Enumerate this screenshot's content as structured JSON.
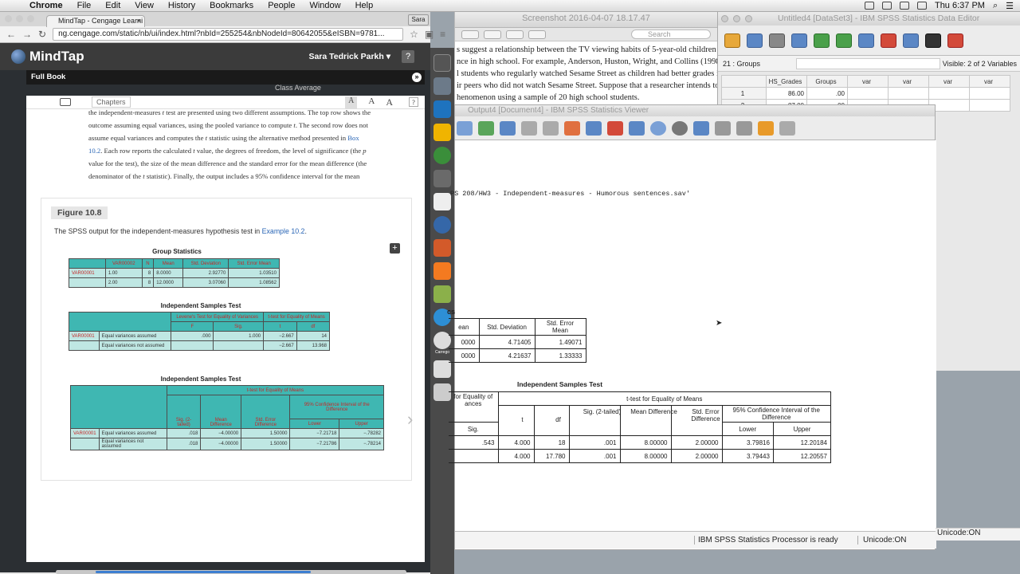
{
  "menubar": {
    "app": "Chrome",
    "items": [
      "File",
      "Edit",
      "View",
      "History",
      "Bookmarks",
      "People",
      "Window",
      "Help"
    ],
    "clock": "Thu 6:37 PM"
  },
  "preview": {
    "title": "Screenshot 2016-04-07 18.17.47",
    "search": "Search",
    "lines": [
      "s suggest a relationship between the TV viewing habits of 5-year-old children and",
      "nce in high school. For example, Anderson, Huston, Wright, and Collins (1998) rep",
      "l students who regularly watched Sesame Street as children had better grades in h",
      "ir peers who did not watch Sesame Street. Suppose that a researcher intends to",
      "henomenon using a sample of 20 high school students."
    ]
  },
  "editor": {
    "title": "Untitled4 [DataSet3] - IBM SPSS Statistics Data Editor",
    "cell_name": "21 : Groups",
    "visible": "Visible: 2 of 2 Variables",
    "cols": [
      "HS_Grades",
      "Groups",
      "var",
      "var",
      "var",
      "var"
    ],
    "rows": [
      {
        "n": "1",
        "a": "86.00",
        "b": ".00"
      },
      {
        "n": "2",
        "a": "87.00",
        "b": ".00"
      }
    ]
  },
  "chrome": {
    "tab": "MindTap - Cengage Learni",
    "profile": "Sara",
    "url": "ng.cengage.com/static/nb/ui/index.html?nbId=255254&nbNodeId=80642055&eISBN=9781..."
  },
  "mindtap": {
    "logo": "MindTap",
    "user": "Sara Tedrick Parkh",
    "help": "?",
    "fullbook": "Full Book",
    "class_avg": "Class Average",
    "chapters": "Chapters",
    "font_sizes": [
      "A",
      "A",
      "A"
    ],
    "q": "?"
  },
  "reader": {
    "para": [
      {
        "t": "the independent-measures "
      },
      {
        "t": "t",
        "i": true
      },
      {
        "t": " test are presented using two different assumptions. The top row shows the outcome assuming equal variances, using the pooled variance to compute "
      },
      {
        "t": "t",
        "i": true
      },
      {
        "t": ". The second row does not assume equal variances and computes the "
      },
      {
        "t": "t",
        "i": true
      },
      {
        "t": " statistic using the alternative method presented in "
      },
      {
        "t": "Box 10.2",
        "lk": true
      },
      {
        "t": ". Each row reports the calculated "
      },
      {
        "t": "t",
        "i": true
      },
      {
        "t": " value, the degrees of freedom, the level of significance (the "
      },
      {
        "t": "p",
        "i": true
      },
      {
        "t": " value for the test), the size of the mean difference and the standard error for the mean difference (the denominator of the "
      },
      {
        "t": "t",
        "i": true
      },
      {
        "t": " statistic). Finally, the output includes a 95% confidence interval for the mean difference."
      }
    ],
    "fig_label": "Figure 10.8",
    "fig_caption_pre": "The SPSS output for the independent-measures hypothesis test in ",
    "fig_caption_link": "Example 10.2",
    "fig_caption_post": ".",
    "gs_title": "Group Statistics",
    "gs_head": [
      "",
      "VAR00002",
      "N",
      "Mean",
      "Std. Deviation",
      "Std. Error Mean"
    ],
    "gs_rows": [
      [
        "VAR00001",
        "1.00",
        "8",
        "8.0000",
        "2.92770",
        "1.03510"
      ],
      [
        "",
        "2.00",
        "8",
        "12.0000",
        "3.07060",
        "1.08562"
      ]
    ],
    "ist1_title": "Independent Samples Test",
    "ist1_groups": [
      "Levene's Test for Equality of Variances",
      "t-test for Equality of Means"
    ],
    "ist1_head": [
      "F",
      "Sig.",
      "t",
      "df"
    ],
    "ist1_rows": [
      [
        "VAR00001",
        "Equal variances assumed",
        ".000",
        "1.000",
        "−2.667",
        "14"
      ],
      [
        "",
        "Equal variances not assumed",
        "",
        "",
        "−2.667",
        "13.968"
      ]
    ],
    "ist2_title": "Independent Samples Test",
    "ist2_group": "t-test for Equality of Means",
    "ist2_ci": "95% Confidence Interval of the Difference",
    "ist2_head": [
      "Sig. (2-tailed)",
      "Mean Difference",
      "Std. Error Difference",
      "Lower",
      "Upper"
    ],
    "ist2_rows": [
      [
        "VAR00001",
        "Equal variances assumed",
        ".018",
        "−4.00000",
        "1.50000",
        "−7.21718",
        "−.78282"
      ],
      [
        "",
        "Equal variances not assumed",
        ".018",
        "−4.00000",
        "1.50000",
        "−7.21786",
        "−.78214"
      ]
    ]
  },
  "viewer": {
    "title": "Output4 [Document4] - IBM SPSS Statistics Viewer",
    "cmd": "PS 208/HW3 - Independent-measures - Humorous sentences.sav'",
    "stats_label": "cs",
    "gs_head": [
      "ean",
      "Std. Deviation",
      "Std. Error Mean"
    ],
    "gs_rows": [
      [
        "0000",
        "4.71405",
        "1.49071"
      ],
      [
        "0000",
        "4.21637",
        "1.33333"
      ]
    ],
    "ist_title": "Independent Samples Test",
    "levene_frag": "for Equality of ances",
    "ttest": "t-test for Equality of Means",
    "ci": "95% Confidence Interval of the Difference",
    "head": [
      "Sig.",
      "t",
      "df",
      "Sig. (2-tailed)",
      "Mean Difference",
      "Std. Error Difference",
      "Lower",
      "Upper"
    ],
    "rows": [
      [
        ".543",
        "4.000",
        "18",
        ".001",
        "8.00000",
        "2.00000",
        "3.79816",
        "12.20184"
      ],
      [
        "",
        "4.000",
        "17.780",
        ".001",
        "8.00000",
        "2.00000",
        "3.79443",
        "12.20557"
      ]
    ],
    "status": "IBM SPSS Statistics Processor is ready",
    "unicode": "Unicode:ON",
    "unicode2": "Unicode:ON"
  },
  "dock": {
    "carrego": "Carrego"
  }
}
